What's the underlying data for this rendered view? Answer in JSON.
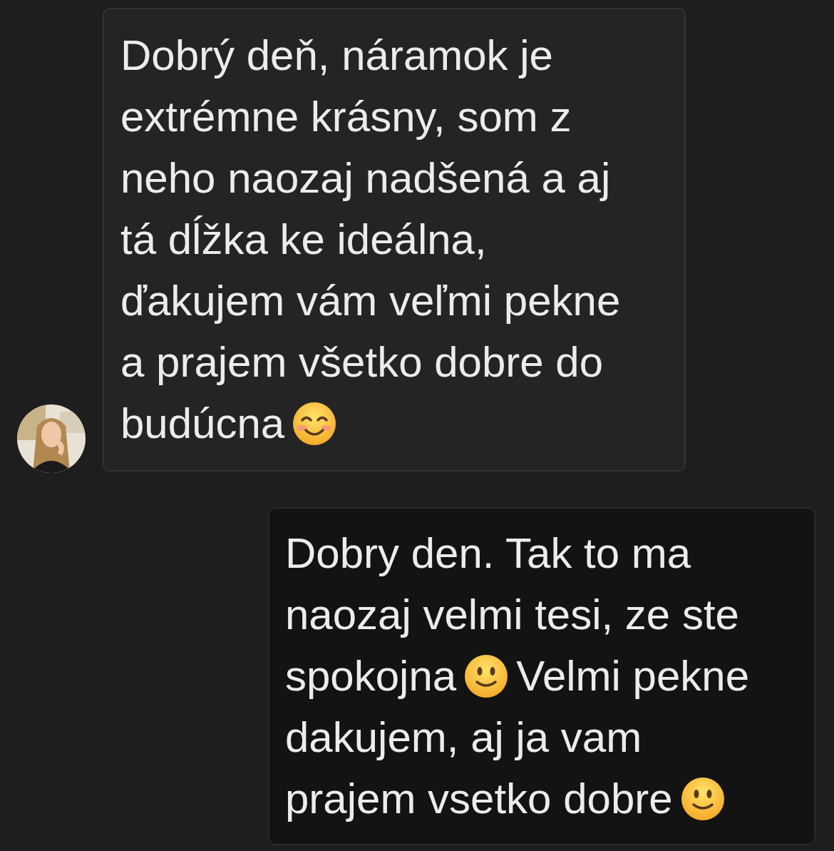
{
  "messages": [
    {
      "kind": "received",
      "avatar": {
        "kind": "picture"
      },
      "lines": [
        [
          {
            "kind": "text",
            "text": "Dobrý deň, náramok je"
          }
        ],
        [
          {
            "kind": "text",
            "text": "extrémne krásny, som z"
          }
        ],
        [
          {
            "kind": "text",
            "text": "neho naozaj nadšená a aj"
          }
        ],
        [
          {
            "kind": "text",
            "text": "tá dĺžka ke ideálna,"
          }
        ],
        [
          {
            "kind": "text",
            "text": "ďakujem vám veľmi pekne"
          }
        ],
        [
          {
            "kind": "text",
            "text": "a prajem všetko dobre do"
          }
        ],
        [
          {
            "kind": "text",
            "text": "budúcna"
          },
          {
            "kind": "blush"
          }
        ]
      ]
    },
    {
      "kind": "sent",
      "lines": [
        [
          {
            "kind": "text",
            "text": "Dobry den. Tak to ma"
          }
        ],
        [
          {
            "kind": "text",
            "text": "naozaj velmi tesi, ze ste"
          }
        ],
        [
          {
            "kind": "text",
            "text": "spokojna"
          },
          {
            "kind": "smile"
          },
          {
            "kind": "text",
            "text": "Velmi pekne"
          }
        ],
        [
          {
            "kind": "text",
            "text": "dakujem, aj ja vam"
          }
        ],
        [
          {
            "kind": "text",
            "text": "prajem vsetko dobre"
          },
          {
            "kind": "smile"
          }
        ]
      ]
    }
  ]
}
